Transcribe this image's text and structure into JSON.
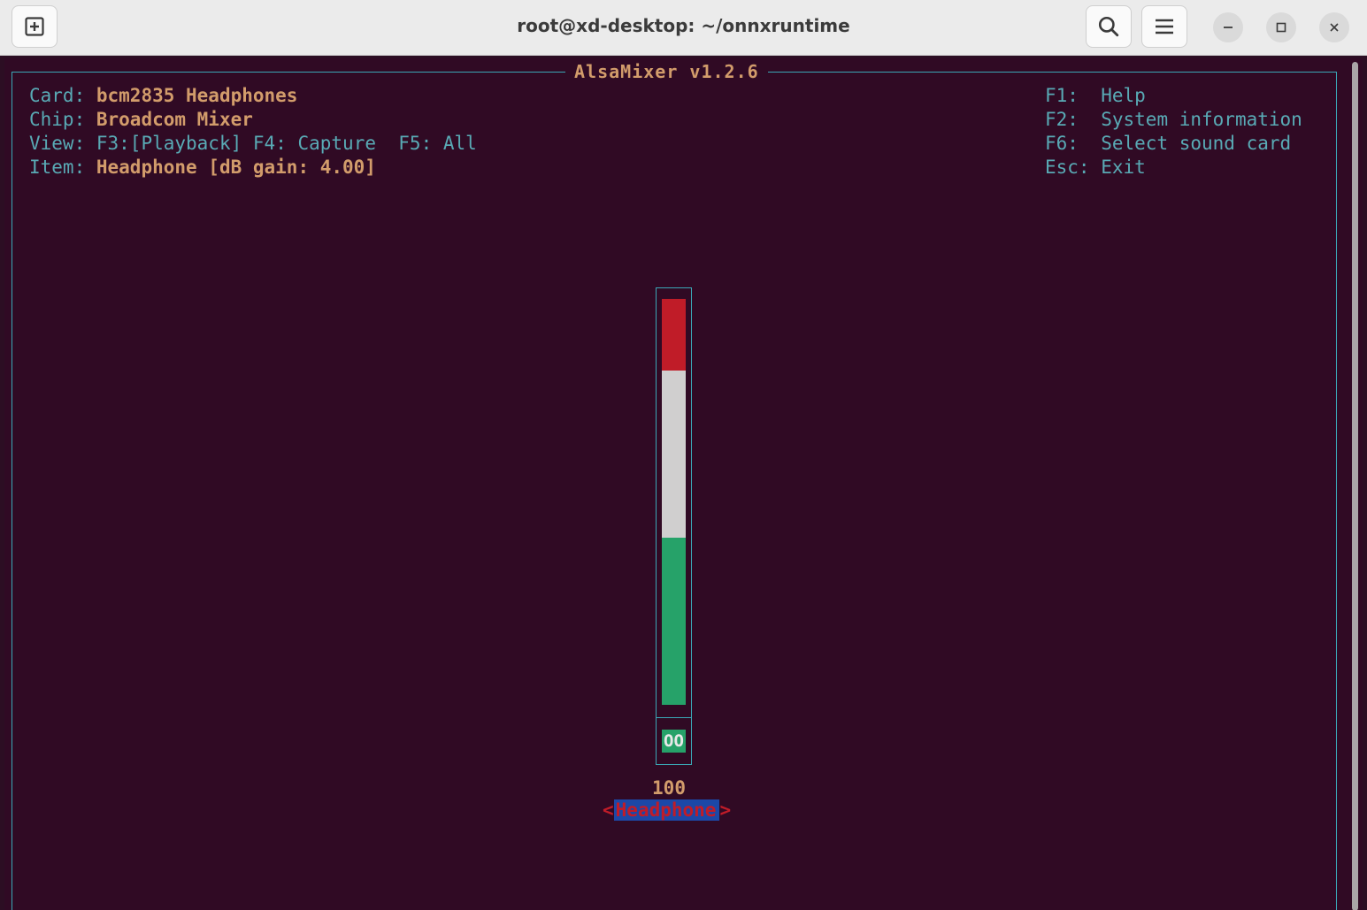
{
  "window": {
    "title": "root@xd-desktop: ~/onnxruntime",
    "buttons": {
      "new_tab_icon": "plus-square-icon",
      "search_icon": "search-icon",
      "menu_icon": "hamburger-menu-icon",
      "minimize_icon": "minimize-icon",
      "maximize_icon": "maximize-icon",
      "close_icon": "close-icon"
    }
  },
  "alsamixer": {
    "title": "AlsaMixer v1.2.6",
    "info": {
      "card_label": "Card:",
      "card_value": "bcm2835 Headphones",
      "chip_label": "Chip:",
      "chip_value": "Broadcom Mixer",
      "view_label": "View:",
      "view_playback": "F3:[Playback]",
      "view_capture": "F4: Capture",
      "view_all": "F5: All",
      "item_label": "Item:",
      "item_value": "Headphone [dB gain: 4.00]"
    },
    "help": [
      {
        "key": "F1:",
        "action": "Help"
      },
      {
        "key": "F2:",
        "action": "System information"
      },
      {
        "key": "F6:",
        "action": "Select sound card"
      },
      {
        "key": "Esc:",
        "action": "Exit"
      }
    ],
    "control": {
      "name": "Headphone",
      "left_arrow": "<",
      "right_arrow": ">",
      "level_value": "100",
      "state_badge": "OO",
      "level_fraction": 1.0
    },
    "colors": {
      "background": "#300a24",
      "label": "#59aab5",
      "value": "#d29c6b",
      "bar_high": "#c01c28",
      "bar_mid": "#d0cfcf",
      "bar_low": "#26a269",
      "selection": "#1c48a7"
    }
  }
}
